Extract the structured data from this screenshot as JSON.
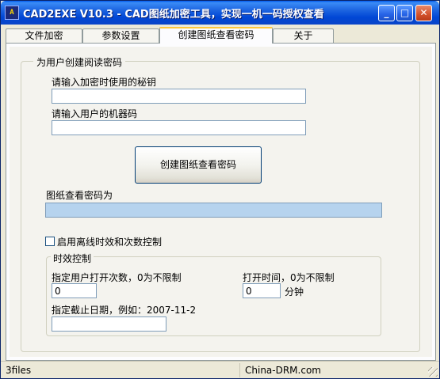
{
  "window": {
    "title": "CAD2EXE V10.3 - CAD图纸加密工具，实现一机一码授权查看",
    "icon": "app-icon",
    "icon_text": "A",
    "controls": {
      "minimize": "_",
      "maximize": "□",
      "close": "✕"
    }
  },
  "tabs": [
    {
      "label": "文件加密",
      "active": false
    },
    {
      "label": "参数设置",
      "active": false
    },
    {
      "label": "创建图纸查看密码",
      "active": true
    },
    {
      "label": "关于",
      "active": false
    }
  ],
  "group": {
    "title": "为用户创建阅读密码",
    "secret_key_label": "请输入加密时使用的秘钥",
    "secret_key_value": "",
    "machine_code_label": "请输入用户的机器码",
    "machine_code_value": "",
    "create_button": "创建图纸查看密码",
    "result_label": "图纸查看密码为",
    "result_value": ""
  },
  "offline": {
    "checkbox_label": "启用离线时效和次数控制",
    "checked": false
  },
  "time_control": {
    "title": "时效控制",
    "open_count_label": "指定用户打开次数，0为不限制",
    "open_count_value": "0",
    "open_time_label": "打开时间，0为不限制",
    "open_time_value": "0",
    "open_time_unit": "分钟",
    "expiry_label": "指定截止日期，例如：2007-11-2",
    "expiry_value": ""
  },
  "statusbar": {
    "left": "3files",
    "right": "China-DRM.com"
  },
  "colors": {
    "titlebar": "#0046d5",
    "face": "#ece9d8",
    "result_fill": "#b6d3ee",
    "active_tab_accent": "#ffc83c"
  }
}
